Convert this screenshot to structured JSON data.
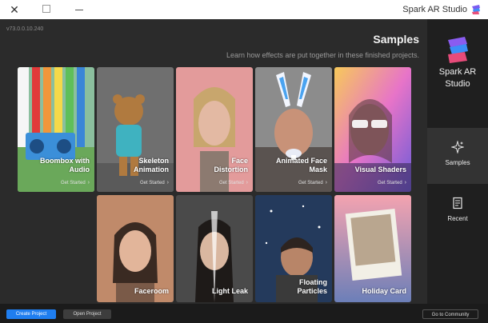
{
  "window": {
    "title": "Spark AR Studio"
  },
  "main": {
    "version": "v73.0.0.10.240",
    "heading": "Samples",
    "subheading": "Learn how effects are put together in these finished projects."
  },
  "sidebar": {
    "brand_line1": "Spark AR",
    "brand_line2": "Studio",
    "items": [
      {
        "label": "Samples",
        "icon": "sparkle-icon",
        "active": true
      },
      {
        "label": "Recent",
        "icon": "document-icon",
        "active": false
      }
    ]
  },
  "cards": [
    {
      "title_line1": "Visual Shaders",
      "title_line2": "",
      "cta": "Get Started"
    },
    {
      "title_line1": "Animated Face",
      "title_line2": "Mask",
      "cta": "Get Started"
    },
    {
      "title_line1": "Face",
      "title_line2": "Distortion",
      "cta": "Get Started"
    },
    {
      "title_line1": "Skeleton",
      "title_line2": "Animation",
      "cta": "Get Started"
    },
    {
      "title_line1": "Boombox with",
      "title_line2": "Audio",
      "cta": "Get Started"
    },
    {
      "title_line1": "Holiday Card",
      "title_line2": ""
    },
    {
      "title_line1": "Floating",
      "title_line2": "Particles"
    },
    {
      "title_line1": "Light Leak",
      "title_line2": ""
    },
    {
      "title_line1": "Faceroom",
      "title_line2": ""
    }
  ],
  "bottombar": {
    "create_label": "Create Project",
    "open_label": "Open Project",
    "community_label": "Go to Community"
  },
  "colors": {
    "accent": "#1f7ef0",
    "sidebar_bg": "#1f1f1f",
    "main_bg": "#2b2b2b"
  }
}
